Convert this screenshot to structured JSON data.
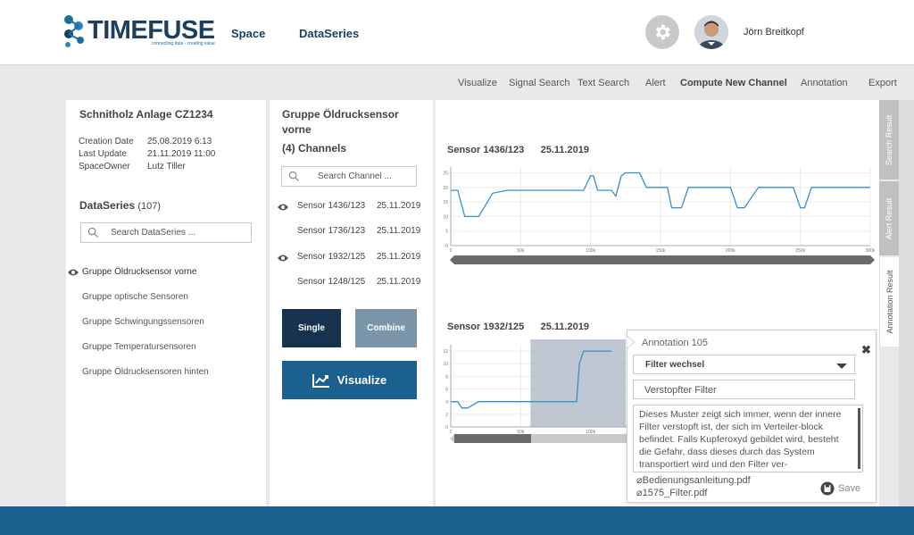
{
  "header": {
    "logo_text": "TIMEFUSE",
    "logo_tagline": "connecting data - creating value",
    "nav": [
      "Space",
      "DataSeries"
    ],
    "user_name": "Jörn Breitkopf"
  },
  "toolbar": [
    "Visualize",
    "Signal Search",
    "Text Search",
    "Alert",
    "Compute New Channel",
    "Annotation",
    "Export"
  ],
  "space": {
    "title": "Schnitholz Anlage CZ1234",
    "meta": [
      {
        "k": "Creation Date",
        "v": "25.08.2019 6:13"
      },
      {
        "k": "Last Update",
        "v": "21.11.2019 11:00"
      },
      {
        "k": "SpaceOwner",
        "v": "Lutz Tiller"
      }
    ],
    "dataseries_label": "DataSeries",
    "dataseries_count": "(107)",
    "search_placeholder": "Search  DataSeries ...",
    "groups": [
      "Gruppe Öldrucksensor vorne",
      "Gruppe optische Sensoren",
      "Gruppe Schwingungssensoren",
      "Gruppe Temperatursensoren",
      "Gruppe Öldrucksensoren hinten"
    ]
  },
  "group": {
    "title": "Gruppe Öldrucksensor vorne",
    "channels_label": "(4) Channels",
    "search_placeholder": "Search  Channel ...",
    "channels": [
      {
        "name": "Sensor 1436/123",
        "date": "25.11.2019",
        "visible": true
      },
      {
        "name": "Sensor 1736/123",
        "date": "25.11.2019",
        "visible": false
      },
      {
        "name": "Sensor 1932/125",
        "date": "25.11.2019",
        "visible": true
      },
      {
        "name": "Sensor 1248/125",
        "date": "25.11.2019",
        "visible": false
      }
    ],
    "single_label": "Single",
    "combine_label": "Combine",
    "visualize_label": "Visualize"
  },
  "charts": [
    {
      "name": "Sensor 1436/123",
      "date": "25.11.2019"
    },
    {
      "name": "Sensor 1932/125",
      "date": "25.11.2019"
    }
  ],
  "chart_data": [
    {
      "type": "line",
      "x": [
        0,
        5000,
        10000,
        20000,
        30000,
        40000,
        60000,
        80000,
        95000,
        100000,
        102000,
        105000,
        115000,
        118000,
        122000,
        125000,
        128000,
        135000,
        140000,
        150000,
        155000,
        158000,
        165000,
        170000,
        180000,
        190000,
        200000,
        205000,
        210000,
        220000,
        235000,
        245000,
        250000,
        253000,
        258000,
        270000,
        285000,
        300000
      ],
      "values": [
        19,
        19,
        10,
        10,
        18,
        19,
        19,
        19,
        19,
        24,
        24,
        19,
        19,
        17,
        24,
        25,
        25,
        25,
        20,
        20,
        20,
        13,
        13,
        20,
        20,
        20,
        20,
        13,
        13,
        20,
        20,
        20,
        13,
        13,
        20,
        20,
        20,
        20
      ],
      "xticks": [
        "0",
        "50k",
        "100k",
        "150k",
        "200k",
        "250k",
        "300k"
      ],
      "yticks": [
        "0",
        "5",
        "10",
        "15",
        "20",
        "25"
      ],
      "ylim": [
        0,
        27
      ],
      "grid": true
    },
    {
      "type": "line",
      "x": [
        0,
        5000,
        8000,
        12000,
        20000,
        30000,
        40000,
        60000,
        80000,
        90000,
        92000,
        95000,
        100000,
        105000,
        110000,
        115000
      ],
      "values": [
        4,
        4,
        3,
        3,
        4,
        4,
        4,
        4,
        4,
        4,
        10,
        12,
        12,
        12,
        12,
        12
      ],
      "xticks": [
        "0",
        "50k",
        "100k"
      ],
      "yticks": [
        "0",
        "2",
        "4",
        "6",
        "8",
        "10",
        "12"
      ],
      "ylim": [
        0,
        13
      ],
      "grid": true
    }
  ],
  "side_tabs": [
    "Search Result",
    "Alert Result",
    "Annotation  Result"
  ],
  "annotation": {
    "title": "Annotation 105",
    "category": "Filter wechsel",
    "label": "Verstopfter Filter",
    "text": "Dieses Muster zeigt sich immer, wenn der innere Filter verstopft ist, der sich im Verteiler-block befindet. Falls Kupferoxyd gebildet wird, besteht die Gefahr, dass dieses durch das System transportiert wird und den Filter ver-",
    "attachments": [
      "Bedienungsanleitung.pdf",
      "1575_Filter.pdf"
    ],
    "save_label": "Save"
  },
  "colors": {
    "navy": "#16324f",
    "accent_blue": "#1a6190",
    "line_blue": "#3a8fc8",
    "combine_gray": "#7a95aa"
  }
}
